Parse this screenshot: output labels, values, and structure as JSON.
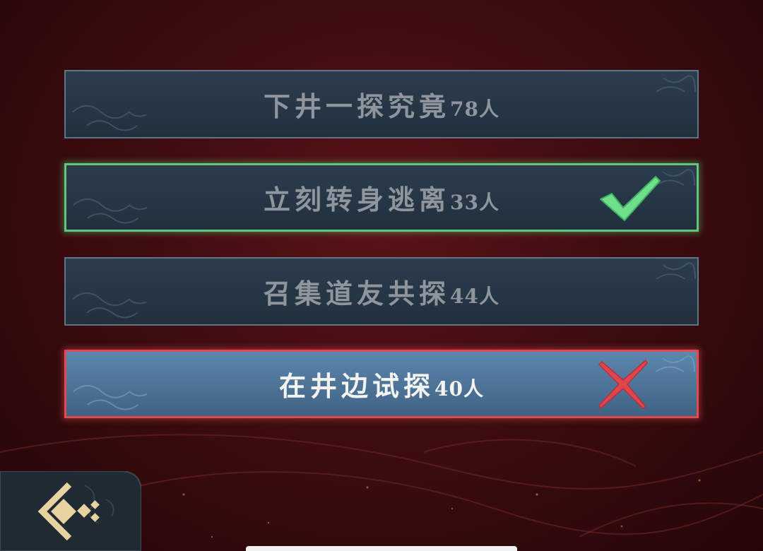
{
  "options": [
    {
      "label": "下井一探究竟",
      "count": "78人",
      "state": "normal"
    },
    {
      "label": "立刻转身逃离",
      "count": "33人",
      "state": "correct"
    },
    {
      "label": "召集道友共探",
      "count": "44人",
      "state": "normal"
    },
    {
      "label": "在井边试探",
      "count": "40人",
      "state": "wrong"
    }
  ],
  "icons": {
    "correct_mark": "checkmark-icon",
    "wrong_mark": "cross-icon",
    "back": "back-arrow-icon"
  },
  "colors": {
    "background": "#4a1014",
    "option_fill": "#2a3a4a",
    "option_border": "#5f7587",
    "correct": "#5ec77a",
    "wrong": "#e04a52",
    "selected_fill": "#5d87ad",
    "back_icon": "#e8d2a0"
  }
}
